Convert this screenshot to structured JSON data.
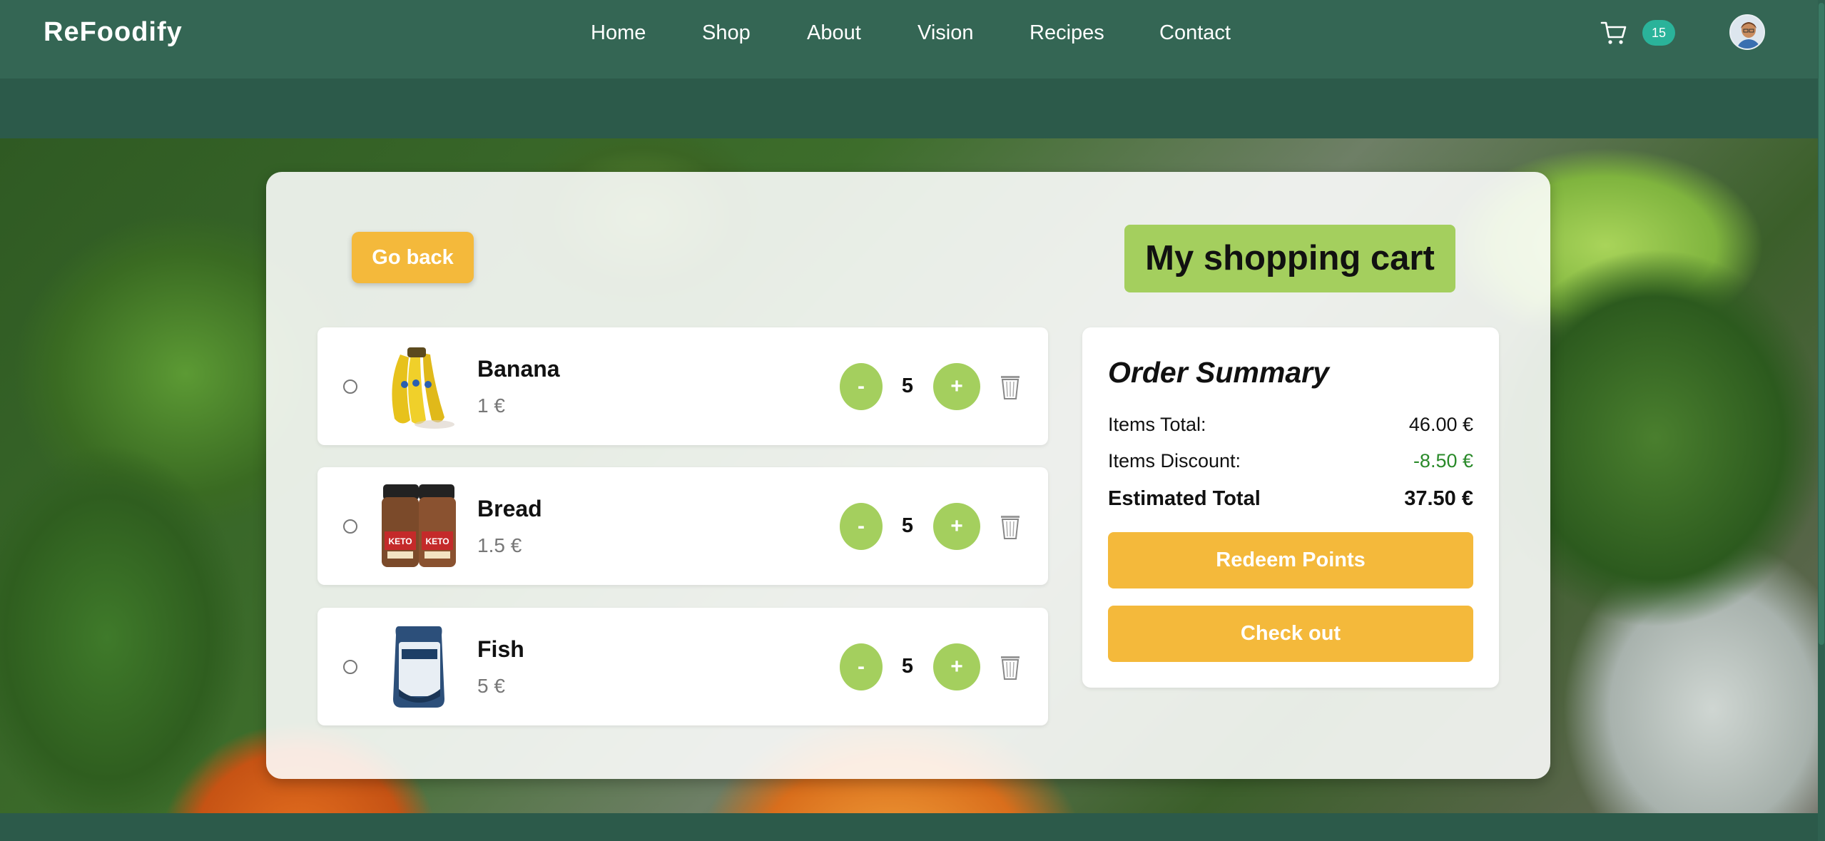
{
  "header": {
    "logo": "ReFoodify",
    "nav": [
      {
        "label": "Home"
      },
      {
        "label": "Shop"
      },
      {
        "label": "About"
      },
      {
        "label": "Vision"
      },
      {
        "label": "Recipes"
      },
      {
        "label": "Contact"
      }
    ],
    "cart_count": "15",
    "cart_icon": "cart-icon",
    "avatar_icon": "avatar"
  },
  "page": {
    "go_back": "Go back",
    "title": "My shopping cart"
  },
  "cart": {
    "items": [
      {
        "name": "Banana",
        "price": "1 €",
        "quantity": "5",
        "minus": "-",
        "plus": "+"
      },
      {
        "name": "Bread",
        "price": "1.5 €",
        "quantity": "5",
        "minus": "-",
        "plus": "+"
      },
      {
        "name": "Fish",
        "price": "5 €",
        "quantity": "5",
        "minus": "-",
        "plus": "+"
      }
    ]
  },
  "summary": {
    "heading": "Order Summary",
    "items_total_label": "Items Total:",
    "items_total_value": "46.00 €",
    "discount_label": "Items Discount:",
    "discount_value": "-8.50 €",
    "estimated_label": "Estimated Total",
    "estimated_value": "37.50 €",
    "redeem_label": "Redeem Points",
    "checkout_label": "Check out"
  },
  "colors": {
    "header_bg": "#346654",
    "accent_green": "#a4cf5e",
    "accent_yellow": "#f4b93b",
    "badge": "#2ab39a",
    "discount": "#2a8a2a"
  }
}
